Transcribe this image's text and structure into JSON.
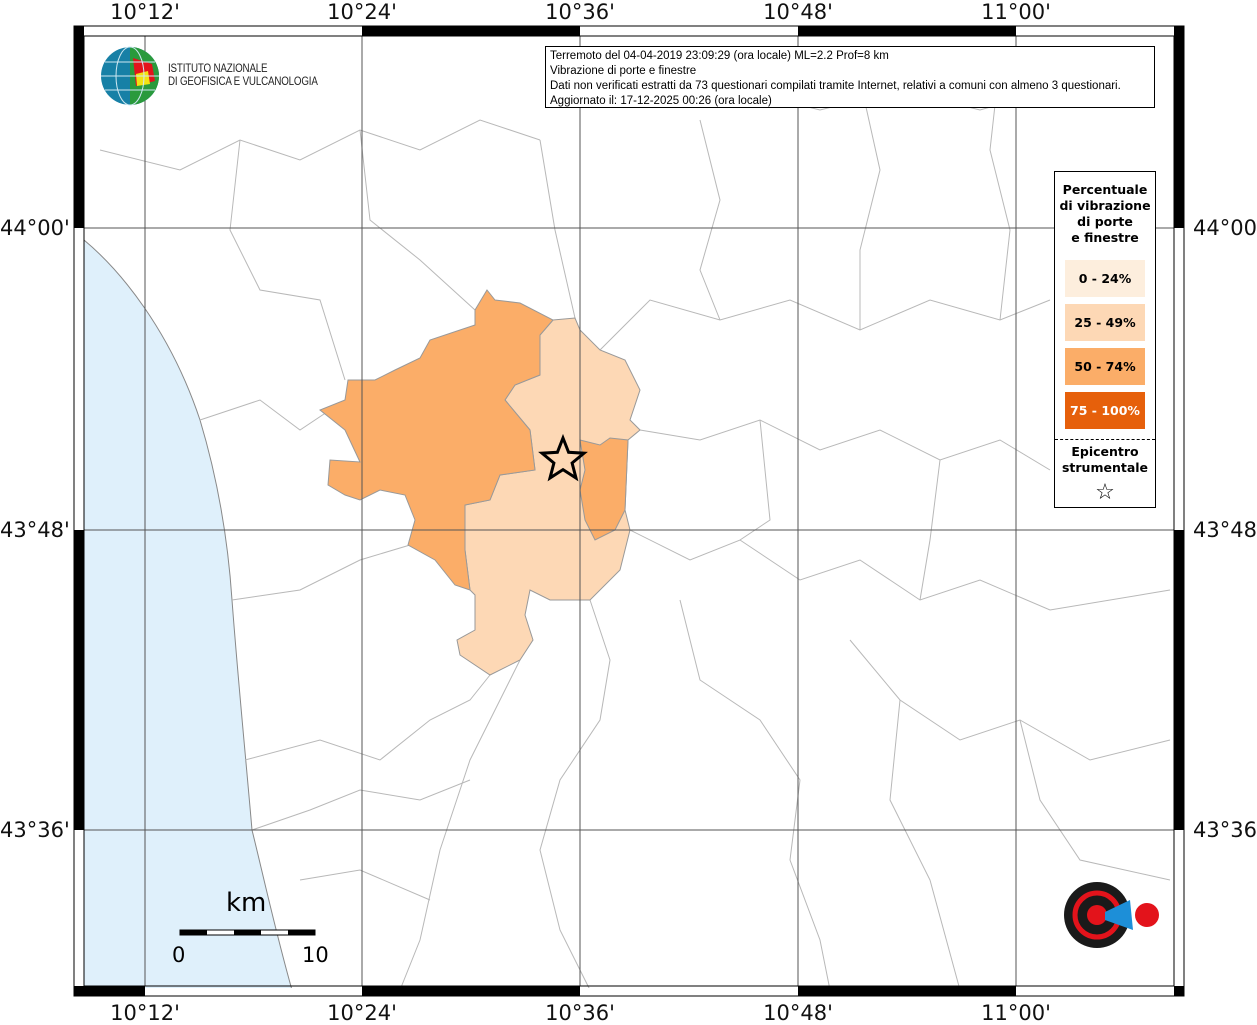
{
  "axes": {
    "top": [
      "10°12'",
      "10°24'",
      "10°36'",
      "10°48'",
      "11°00'"
    ],
    "bottom": [
      "10°12'",
      "10°24'",
      "10°36'",
      "10°48'",
      "11°00'"
    ],
    "left": [
      "44°00'",
      "43°48'",
      "43°36'"
    ],
    "right": [
      "44°00'",
      "43°48'",
      "43°36'"
    ]
  },
  "info": {
    "line1": "Terremoto del 04-04-2019 23:09:29 (ora locale) ML=2.2 Prof=8 km",
    "line2": "Vibrazione di porte e finestre",
    "line3": "Dati non verificati estratti da 73 questionari compilati tramite Internet, relativi a comuni con almeno 3 questionari.",
    "line4": "Aggiornato il: 17-12-2025 00:26 (ora locale)"
  },
  "legend": {
    "title": [
      "Percentuale",
      "di vibrazione",
      "di porte",
      "e finestre"
    ],
    "items": [
      {
        "label": "0 - 24%",
        "color": "#fdeedd",
        "text_color": "#000000"
      },
      {
        "label": "25 - 49%",
        "color": "#fdd8b5",
        "text_color": "#000000"
      },
      {
        "label": "50 - 74%",
        "color": "#fbad68",
        "text_color": "#000000"
      },
      {
        "label": "75 - 100%",
        "color": "#e6600b",
        "text_color": "#ffffff"
      }
    ],
    "epicenter_label": [
      "Epicentro",
      "strumentale"
    ],
    "epicenter_symbol": "☆"
  },
  "logos": {
    "ingv": [
      "ISTITUTO NAZIONALE",
      "DI GEOFISICA E VULCANOLOGIA"
    ],
    "hst": "www.haisentitoilterremoto.it"
  },
  "scale": {
    "unit": "km",
    "min": "0",
    "max": "10"
  },
  "colors": {
    "sea": "#dff0fb",
    "boundary": "#b8b8b8",
    "grid": "#555555"
  }
}
